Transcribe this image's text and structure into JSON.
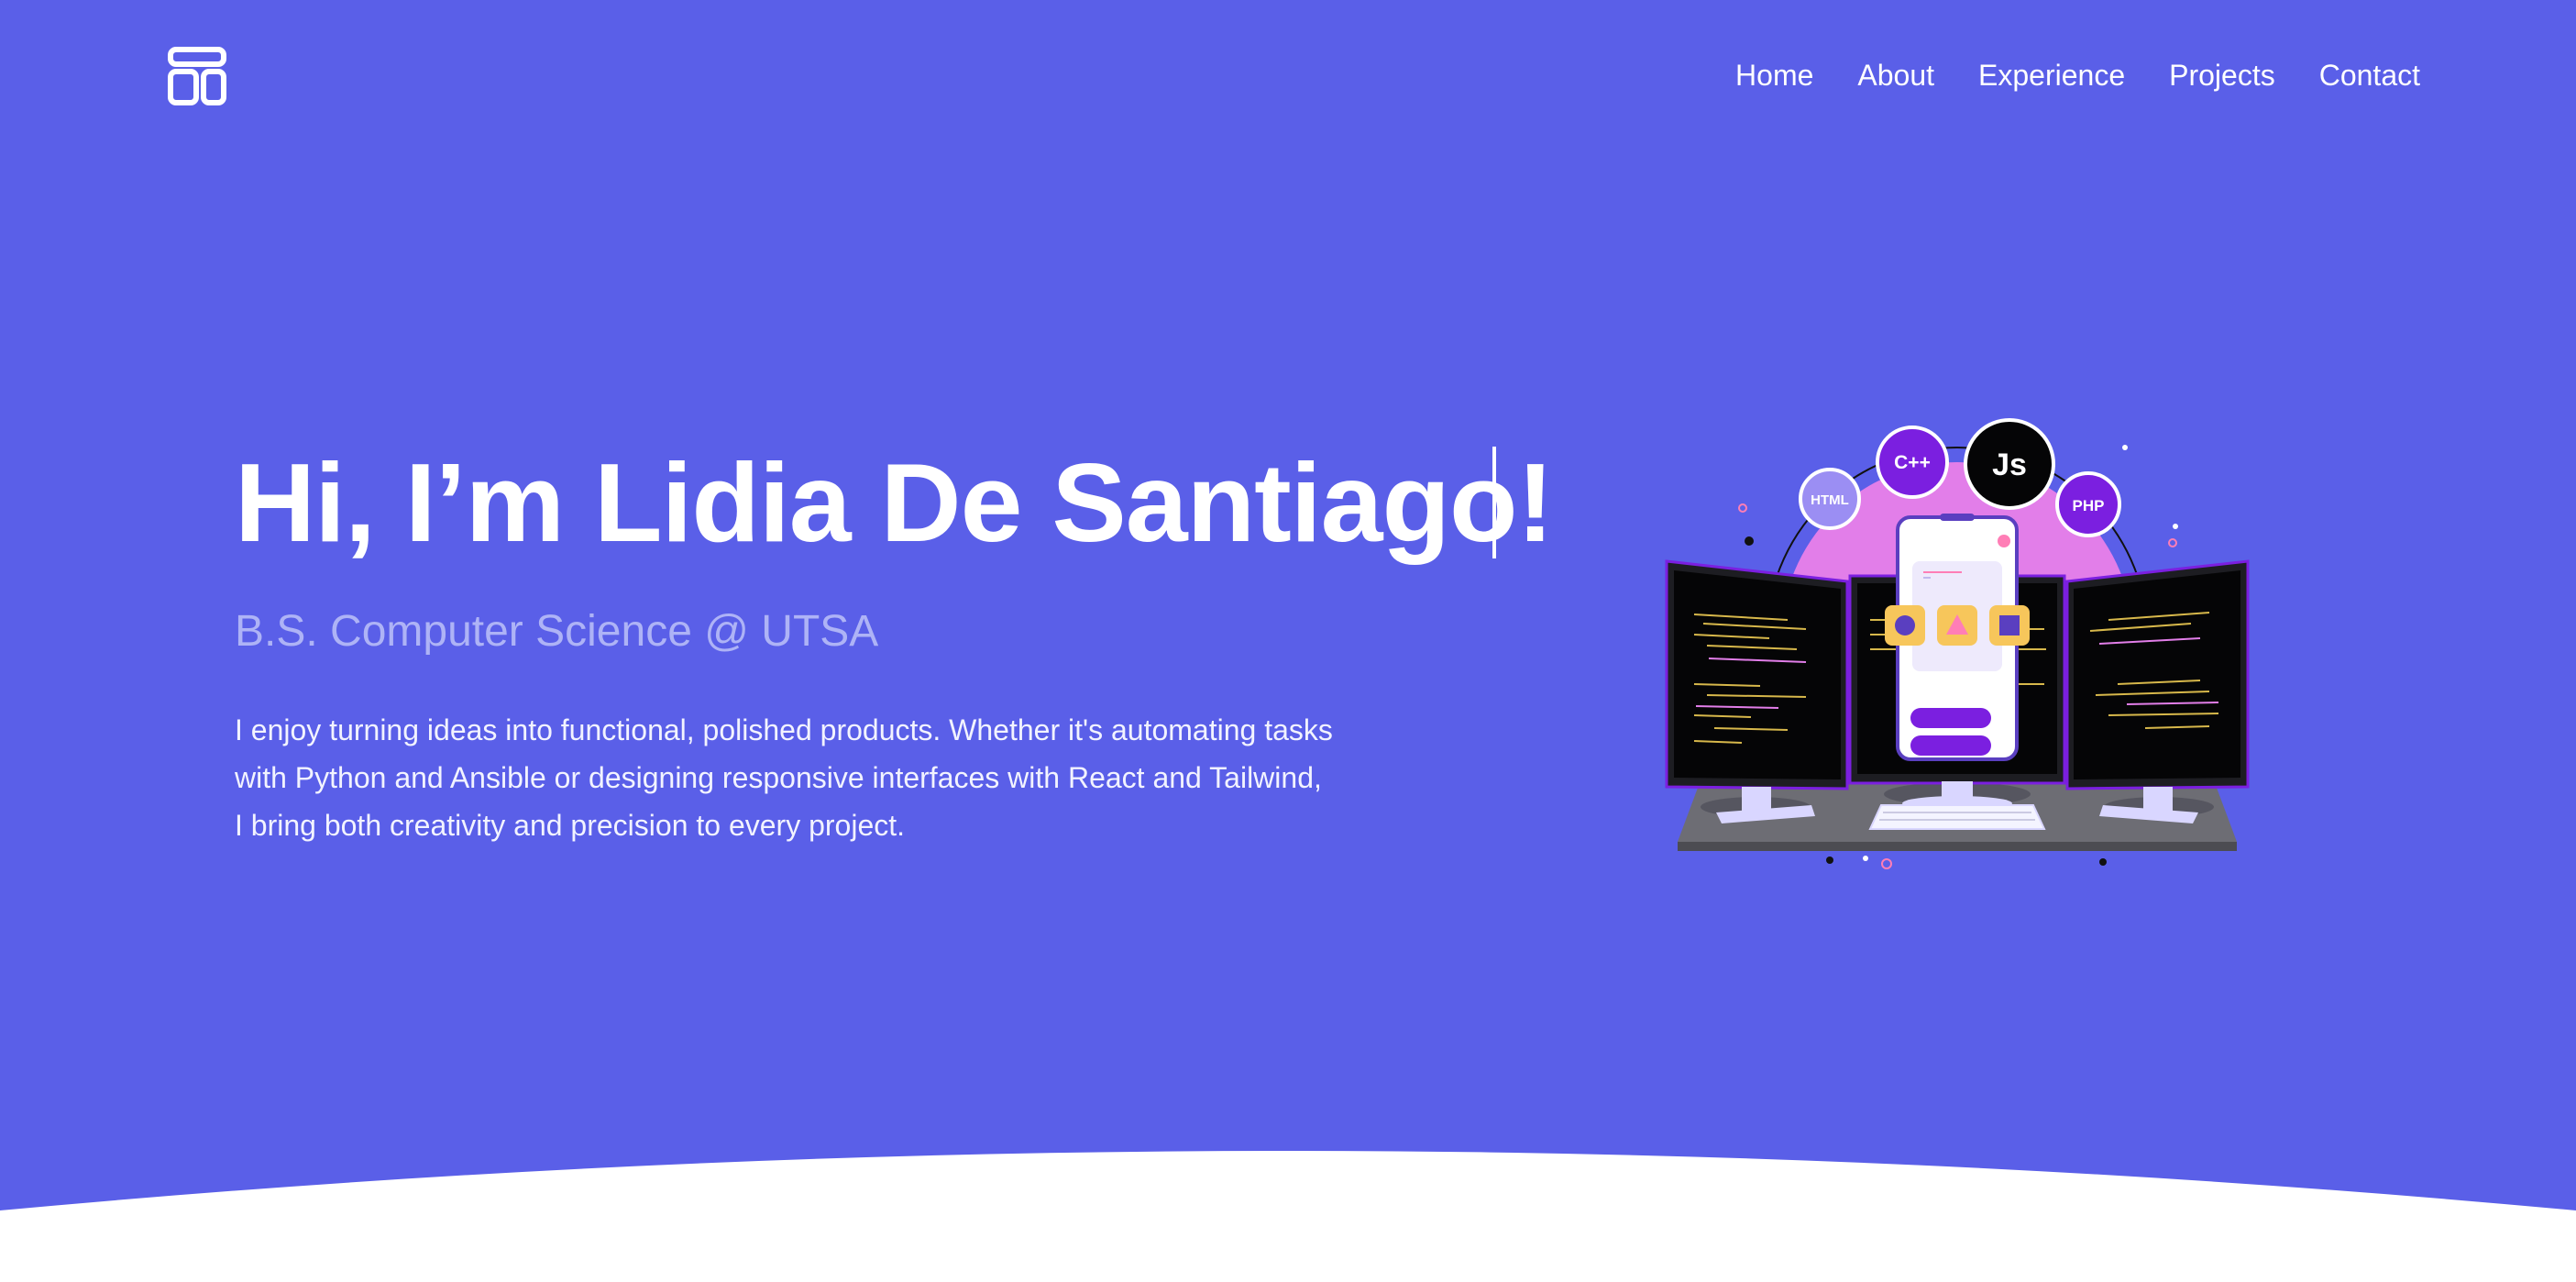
{
  "nav": {
    "logo_icon": "layout-template-icon",
    "items": [
      "Home",
      "About",
      "Experience",
      "Projects",
      "Contact"
    ]
  },
  "hero": {
    "title": "Hi, I’m Lidia De Santiago!",
    "subtitle": "B.S. Computer Science @ UTSA",
    "bio": "I enjoy turning ideas into functional, polished products. Whether it's automating tasks with Python and Ansible or designing responsive interfaces with React and Tailwind, I bring both creativity and precision to every project."
  },
  "illustration": {
    "badges": {
      "html": "HTML",
      "cpp": "C++",
      "js": "Js",
      "php": "PHP"
    }
  },
  "colors": {
    "background": "#5a5fe8",
    "subtitle": "#aeb3f6",
    "accent_purple": "#7b1fe0",
    "accent_pink": "#e27ee9",
    "accent_yellow": "#f7c65b"
  }
}
